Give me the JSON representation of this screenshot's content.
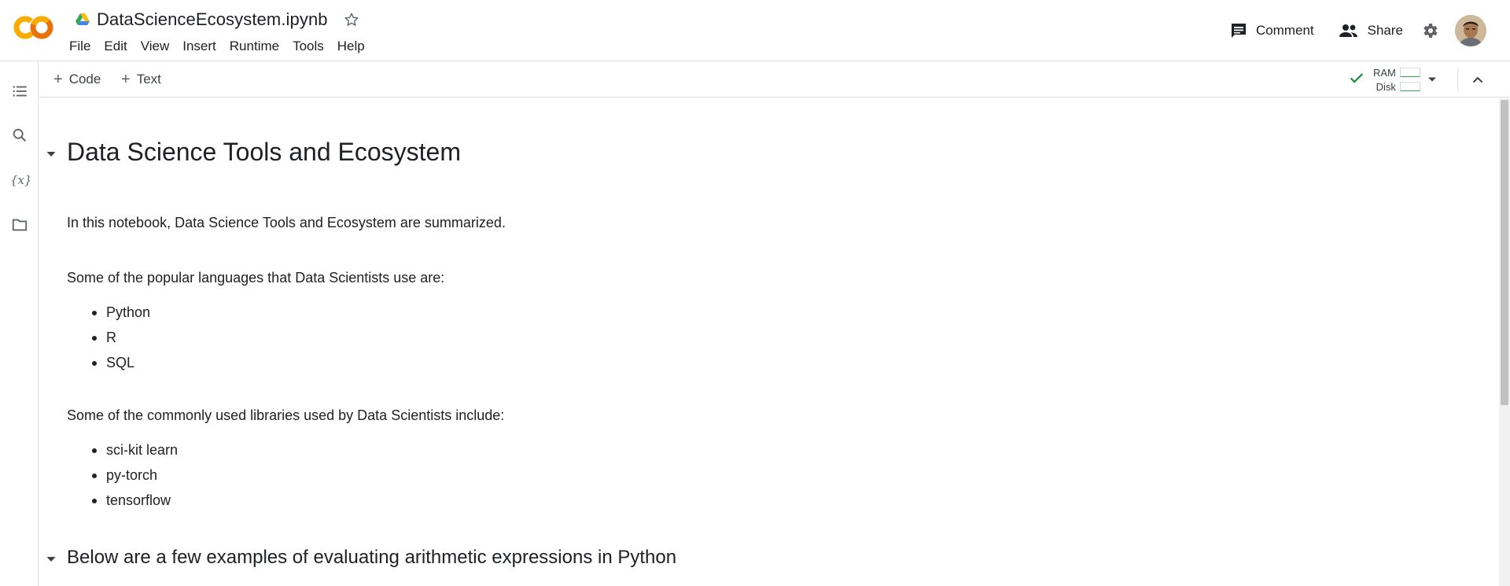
{
  "header": {
    "logo_text": "CO",
    "doc_title": "DataScienceEcosystem.ipynb",
    "menu": [
      "File",
      "Edit",
      "View",
      "Insert",
      "Runtime",
      "Tools",
      "Help"
    ],
    "comment_label": "Comment",
    "share_label": "Share"
  },
  "toolbar": {
    "code_label": "Code",
    "text_label": "Text",
    "ram_label": "RAM",
    "disk_label": "Disk"
  },
  "left_rail": [
    "table-of-contents-icon",
    "search-icon",
    "variables-icon",
    "files-icon"
  ],
  "colors": {
    "accent_orange": "#f9ab00",
    "accent_dark_orange": "#e8710a",
    "status_green": "#1e8e3e"
  },
  "notebook": {
    "title": "Data Science Tools and Ecosystem",
    "intro": "In this notebook, Data Science Tools and Ecosystem are summarized.",
    "languages_heading": "Some of the popular languages that Data Scientists use are:",
    "languages": [
      "Python",
      "R",
      "SQL"
    ],
    "libraries_heading": "Some of the commonly used libraries used by Data Scientists include:",
    "libraries": [
      "sci-kit learn",
      "py-torch",
      "tensorflow"
    ],
    "section2_title": "Below are a few examples of evaluating arithmetic expressions in Python"
  }
}
